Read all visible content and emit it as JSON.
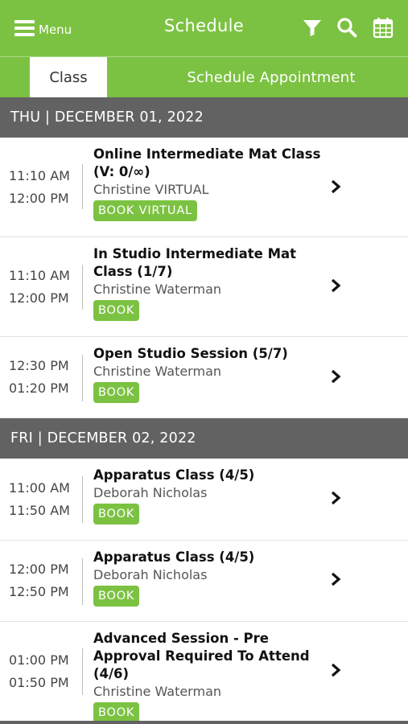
{
  "header": {
    "menu_label": "Menu",
    "title": "Schedule",
    "icons": [
      "menu-icon",
      "filter-icon",
      "search-icon",
      "calendar-icon"
    ]
  },
  "tabs": {
    "class_label": "Class",
    "appointment_label": "Schedule Appointment"
  },
  "colors": {
    "brand_green": "#7cc242",
    "day_header_gray": "#626262"
  },
  "days": [
    {
      "header": "THU | DECEMBER 01, 2022",
      "classes": [
        {
          "start": "11:10 AM",
          "end": "12:00 PM",
          "title": "Online Intermediate Mat Class (V: 0/∞)",
          "instructor": "Christine VIRTUAL",
          "button": "BOOK VIRTUAL"
        },
        {
          "start": "11:10 AM",
          "end": "12:00 PM",
          "title": "In Studio Intermediate Mat Class (1/7)",
          "instructor": "Christine Waterman",
          "button": "BOOK"
        },
        {
          "start": "12:30 PM",
          "end": "01:20 PM",
          "title": "Open Studio Session (5/7)",
          "instructor": "Christine Waterman",
          "button": "BOOK"
        }
      ]
    },
    {
      "header": "FRI | DECEMBER 02, 2022",
      "classes": [
        {
          "start": "11:00 AM",
          "end": "11:50 AM",
          "title": "Apparatus Class (4/5)",
          "instructor": "Deborah Nicholas",
          "button": "BOOK"
        },
        {
          "start": "12:00 PM",
          "end": "12:50 PM",
          "title": "Apparatus Class (4/5)",
          "instructor": "Deborah Nicholas",
          "button": "BOOK"
        },
        {
          "start": "01:00 PM",
          "end": "01:50 PM",
          "title": "Advanced Session - Pre Approval Required To Attend (4/6)",
          "instructor": "Christine Waterman",
          "button": "BOOK"
        }
      ]
    }
  ]
}
